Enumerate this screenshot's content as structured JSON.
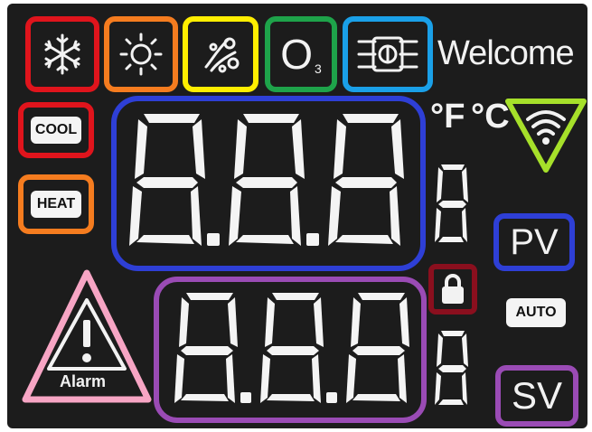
{
  "header": {
    "welcome": "Welcome"
  },
  "icons": {
    "ozone_main": "O",
    "ozone_sub": "3"
  },
  "mode_labels": {
    "cool": "COOL",
    "heat": "HEAT",
    "auto": "AUTO"
  },
  "units": {
    "fahrenheit": "°F",
    "celsius": "°C"
  },
  "values": {
    "pv": "PV",
    "sv": "SV"
  },
  "alarm": {
    "label": "Alarm"
  },
  "highlight_colors": {
    "snowflake": "#e0141c",
    "sun": "#f57c1f",
    "fan": "#ffee00",
    "ozone": "#1ea34a",
    "filter": "#1aa0e8",
    "cool": "#e0141c",
    "heat": "#f57c1f",
    "main_display": "#2e3fd6",
    "secondary_display": "#9a4bb5",
    "wifi": "#a6e02a",
    "pv": "#2e3fd6",
    "lock": "#8a0f1e",
    "sv": "#9a4bb5",
    "alarm": "#f7a5c4"
  }
}
